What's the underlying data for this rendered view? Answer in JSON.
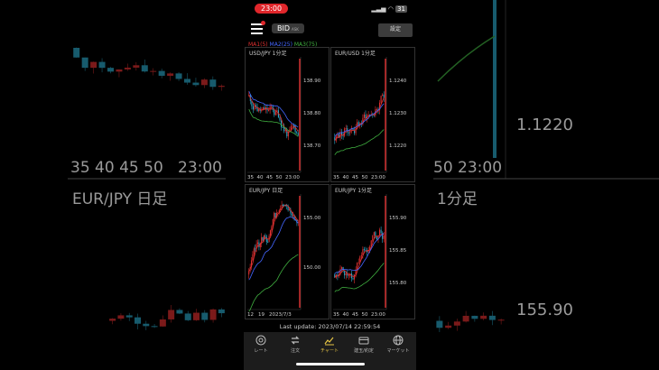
{
  "status_bar": {
    "time": "23:00",
    "battery": "31"
  },
  "top_bar": {
    "price_mode": "BID",
    "price_mode_alt": "ASK",
    "settings_label": "設定"
  },
  "ma_legend": [
    {
      "label": "MA1(5)",
      "color": "#e03030"
    },
    {
      "label": "MA2(25)",
      "color": "#4466ff"
    },
    {
      "label": "MA3(75)",
      "color": "#40b040"
    }
  ],
  "charts": [
    {
      "title": "USD/JPY  1分足",
      "y_labels": [
        "138.90",
        "138.80",
        "138.70"
      ],
      "x_labels": [
        "35",
        "40",
        "45",
        "50",
        "23:00"
      ]
    },
    {
      "title": "EUR/USD  1分足",
      "y_labels": [
        "1.1240",
        "1.1230",
        "1.1220"
      ],
      "x_labels": [
        "35",
        "40",
        "45",
        "50",
        "23:00"
      ]
    },
    {
      "title": "EUR/JPY  日足",
      "y_labels": [
        "155.00",
        "150.00"
      ],
      "x_labels": [
        "12",
        "19",
        "2023/7/3"
      ]
    },
    {
      "title": "EUR/JPY  1分足",
      "y_labels": [
        "155.90",
        "155.85",
        "155.80"
      ],
      "x_labels": [
        "35",
        "40",
        "45",
        "50",
        "23:00"
      ]
    }
  ],
  "last_update": "Last update: 2023/07/14 22:59:54",
  "tabs": [
    {
      "label": "レート",
      "icon": "rate-icon"
    },
    {
      "label": "注文",
      "icon": "order-icon"
    },
    {
      "label": "チャート",
      "icon": "chart-icon",
      "active": true
    },
    {
      "label": "建玉/約定",
      "icon": "position-icon"
    },
    {
      "label": "マーケット",
      "icon": "globe-icon"
    }
  ],
  "background": {
    "left_x_labels": [
      "35",
      "40",
      "45",
      "50",
      "23:00"
    ],
    "left_title": "EUR/JPY  日足",
    "right_x_label": "50  23:00",
    "right_title": "1分足",
    "right_y_top": "1.1220",
    "right_y_bottom": "155.90"
  }
}
